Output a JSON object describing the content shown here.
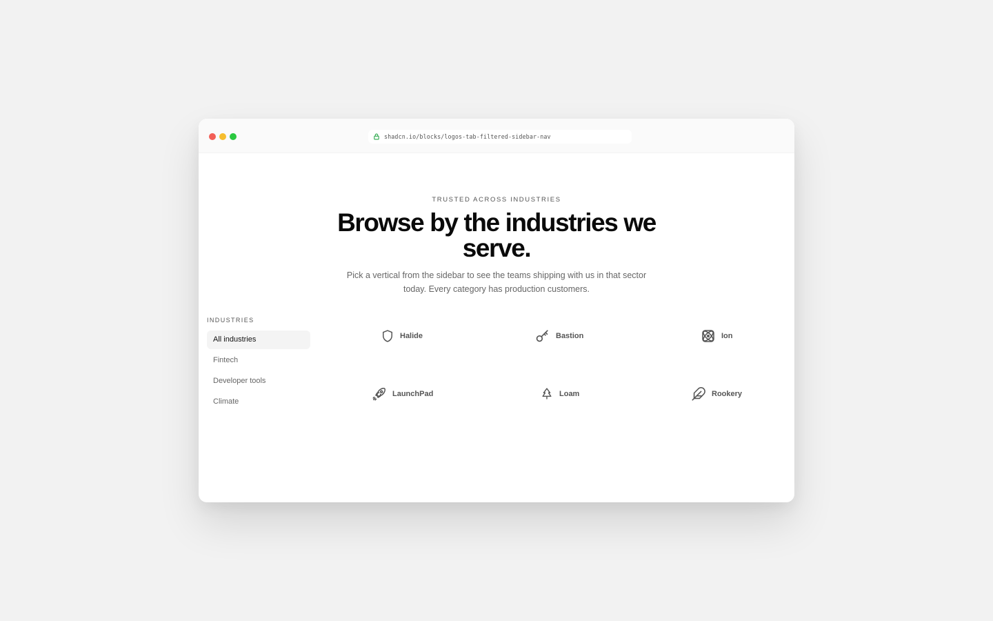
{
  "browser": {
    "url": "shadcn.io/blocks/logos-tab-filtered-sidebar-nav",
    "traffic_lights": {
      "close": "#f25f57",
      "minimize": "#f6bd2e",
      "maximize": "#2ac840"
    },
    "lock_color": "#2aa84a"
  },
  "hero": {
    "eyebrow": "TRUSTED ACROSS INDUSTRIES",
    "headline": "Browse by the industries we serve.",
    "description": "Pick a vertical from the sidebar to see the teams shipping with us in that sector today. Every category has production customers."
  },
  "sidebar": {
    "heading": "INDUSTRIES",
    "items": [
      {
        "label": "All industries",
        "active": true
      },
      {
        "label": "Fintech",
        "active": false
      },
      {
        "label": "Developer tools",
        "active": false
      },
      {
        "label": "Climate",
        "active": false
      }
    ]
  },
  "logos": [
    {
      "name": "Halide",
      "icon": "shield-icon"
    },
    {
      "name": "Bastion",
      "icon": "key-icon"
    },
    {
      "name": "Ion",
      "icon": "atom-icon"
    },
    {
      "name": "LaunchPad",
      "icon": "rocket-icon"
    },
    {
      "name": "Loam",
      "icon": "tree-icon"
    },
    {
      "name": "Rookery",
      "icon": "feather-icon"
    }
  ]
}
